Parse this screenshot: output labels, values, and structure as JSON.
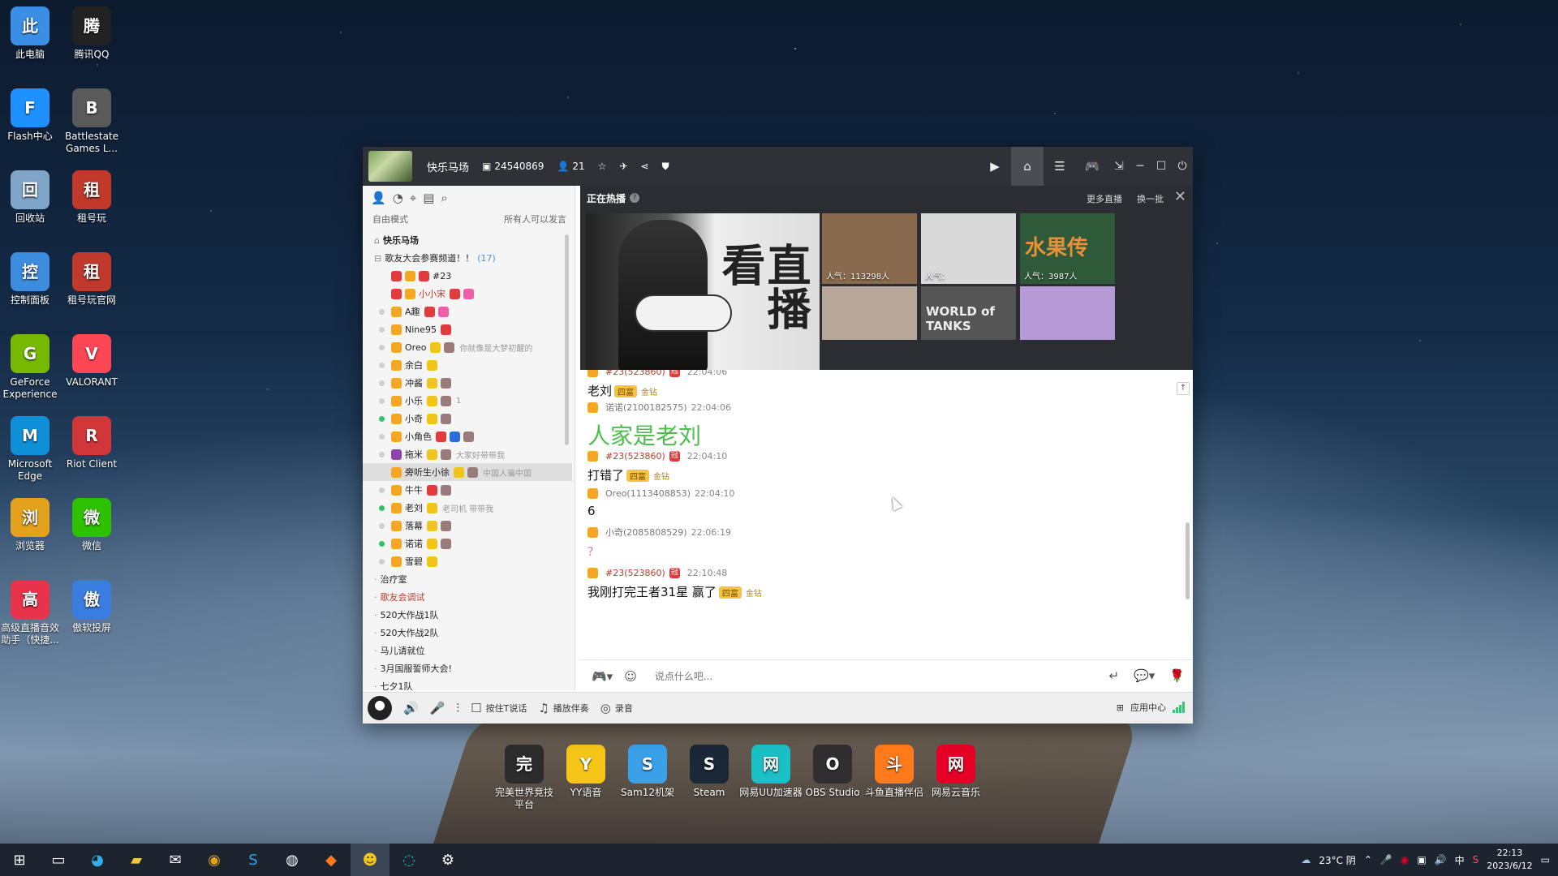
{
  "desktop": {
    "icons_left": [
      {
        "label": "此电脑",
        "icon": "computer-icon",
        "color": "#3a8ee6"
      },
      {
        "label": "腾讯QQ",
        "icon": "qq-icon",
        "color": "#222222"
      },
      {
        "label": "Flash中心",
        "icon": "flash-icon",
        "color": "#1e90ff"
      },
      {
        "label": "Battlestate Games L...",
        "icon": "battlestate-icon",
        "color": "#5a5a5a"
      },
      {
        "label": "回收站",
        "icon": "recycle-bin-icon",
        "color": "#7fa6c9"
      },
      {
        "label": "租号玩",
        "icon": "zuhaowan-icon",
        "color": "#c0392b"
      },
      {
        "label": "控制面板",
        "icon": "control-panel-icon",
        "color": "#3c8dde"
      },
      {
        "label": "租号玩官网",
        "icon": "zuhaowan-site-icon",
        "color": "#c0392b"
      },
      {
        "label": "GeForce Experience",
        "icon": "geforce-icon",
        "color": "#76b900"
      },
      {
        "label": "VALORANT",
        "icon": "valorant-icon",
        "color": "#ff4655"
      },
      {
        "label": "Microsoft Edge",
        "icon": "edge-icon",
        "color": "#0f8fd8"
      },
      {
        "label": "Riot Client",
        "icon": "riot-icon",
        "color": "#d13639"
      },
      {
        "label": "浏览器",
        "icon": "chrome-icon",
        "color": "#e4a11b"
      },
      {
        "label": "微信",
        "icon": "wechat-icon",
        "color": "#2dc100"
      },
      {
        "label": "高级直播音效助手（快捷...",
        "icon": "audio-assistant-icon",
        "color": "#e8334a"
      },
      {
        "label": "傲软投屏",
        "icon": "apowermirror-icon",
        "color": "#3a7de0"
      }
    ],
    "icons_bottom": [
      {
        "label": "完美世界竞技平台",
        "icon": "perfect-world-icon",
        "color": "#2c2c2c"
      },
      {
        "label": "YY语音",
        "icon": "yy-icon",
        "color": "#f5c518"
      },
      {
        "label": "Sam12机架",
        "icon": "sam-rack-icon",
        "color": "#3aa0e8"
      },
      {
        "label": "Steam",
        "icon": "steam-icon",
        "color": "#1b2838"
      },
      {
        "label": "网易UU加速器",
        "icon": "uu-booster-icon",
        "color": "#1ac0c6"
      },
      {
        "label": "OBS Studio",
        "icon": "obs-icon",
        "color": "#302e31"
      },
      {
        "label": "斗鱼直播伴侣",
        "icon": "douyu-icon",
        "color": "#ff7a1a"
      },
      {
        "label": "网易云音乐",
        "icon": "netease-music-icon",
        "color": "#e60026"
      }
    ]
  },
  "window": {
    "channel_name": "快乐马场",
    "channel_id": "24540869",
    "online_count": "21",
    "mode_label": "自由模式",
    "mode_desc": "所有人可以发言"
  },
  "tree": [
    {
      "type": "channel",
      "name": "快乐马场",
      "bold": true,
      "indent": 14
    },
    {
      "type": "channel",
      "name": "歌友大会参赛频道！！",
      "count": "(17)",
      "indent": 14,
      "open": true
    },
    {
      "type": "user",
      "name": "#23",
      "dot": "none",
      "badges": [
        "b-red",
        "b-gift",
        "b-red"
      ],
      "status": ""
    },
    {
      "type": "user",
      "name": "小小宋",
      "dot": "none",
      "badges": [
        "b-red",
        "b-gift"
      ],
      "tail": [
        "b-red",
        "b-pink"
      ],
      "status": "",
      "red": true
    },
    {
      "type": "user",
      "name": "A趣",
      "dot": "gray",
      "badges": [
        "b-gift"
      ],
      "tail": [
        "b-red",
        "b-pink"
      ],
      "status": ""
    },
    {
      "type": "user",
      "name": "Nine95",
      "dot": "gray",
      "badges": [
        "b-gift"
      ],
      "tail": [
        "b-red"
      ],
      "status": ""
    },
    {
      "type": "user",
      "name": "Oreo",
      "dot": "gray",
      "badges": [
        "b-gift"
      ],
      "tail": [
        "b-crown",
        "b-gray"
      ],
      "status": "你就像是大梦初醒的"
    },
    {
      "type": "user",
      "name": "余白",
      "dot": "gray",
      "badges": [
        "b-gift"
      ],
      "tail": [
        "b-crown"
      ],
      "status": ""
    },
    {
      "type": "user",
      "name": "冲酱",
      "dot": "gray",
      "badges": [
        "b-gift"
      ],
      "tail": [
        "b-crown",
        "b-gray"
      ],
      "status": ""
    },
    {
      "type": "user",
      "name": "小乐",
      "dot": "gray",
      "badges": [
        "b-gift"
      ],
      "tail": [
        "b-crown",
        "b-gray"
      ],
      "status": "1"
    },
    {
      "type": "user",
      "name": "小奇",
      "dot": "green",
      "badges": [
        "b-gift"
      ],
      "tail": [
        "b-crown",
        "b-gray"
      ],
      "status": ""
    },
    {
      "type": "user",
      "name": "小角色",
      "dot": "gray",
      "badges": [
        "b-gift"
      ],
      "tail": [
        "b-red",
        "b-blue",
        "b-gray"
      ],
      "status": ""
    },
    {
      "type": "user",
      "name": "拖米",
      "dot": "gray",
      "badges": [
        "b-purple"
      ],
      "tail": [
        "b-crown",
        "b-gray"
      ],
      "status": "大家好带带我"
    },
    {
      "type": "user",
      "name": "旁听生小徐",
      "dot": "none",
      "badges": [
        "b-gift"
      ],
      "tail": [
        "b-crown",
        "b-gray"
      ],
      "status": "中国人骗中国",
      "sel": true
    },
    {
      "type": "user",
      "name": "牛牛",
      "dot": "gray",
      "badges": [
        "b-gift"
      ],
      "tail": [
        "b-red",
        "b-gray"
      ],
      "status": ""
    },
    {
      "type": "user",
      "name": "老刘",
      "dot": "green",
      "badges": [
        "b-gift"
      ],
      "tail": [
        "b-crown"
      ],
      "status": "老司机 带带我"
    },
    {
      "type": "user",
      "name": "落幕",
      "dot": "gray",
      "badges": [
        "b-gift"
      ],
      "tail": [
        "b-crown",
        "b-gray"
      ],
      "status": ""
    },
    {
      "type": "user",
      "name": "诺诺",
      "dot": "green",
      "badges": [
        "b-gift"
      ],
      "tail": [
        "b-crown",
        "b-gray"
      ],
      "status": ""
    },
    {
      "type": "user",
      "name": "雪碧",
      "dot": "gray",
      "badges": [
        "b-gift"
      ],
      "tail": [
        "b-crown"
      ],
      "status": ""
    },
    {
      "type": "channel",
      "name": "治疗室",
      "indent": 14
    },
    {
      "type": "channel",
      "name": "歌友会调试",
      "indent": 14,
      "red": true
    },
    {
      "type": "channel",
      "name": "520大作战1队",
      "indent": 14
    },
    {
      "type": "channel",
      "name": "520大作战2队",
      "indent": 14
    },
    {
      "type": "channel",
      "name": "马儿请就位",
      "indent": 14
    },
    {
      "type": "channel",
      "name": "3月国服誓师大会!",
      "indent": 14
    },
    {
      "type": "channel",
      "name": "七夕1队",
      "indent": 14
    }
  ],
  "hot": {
    "title": "正在热播",
    "more": "更多直播",
    "refresh": "换一批",
    "big_text": "直播看",
    "thumbs": [
      {
        "pop": "人气：113298人",
        "color": "#8a6a4e"
      },
      {
        "pop": "人气：",
        "color": "#d9d9d9"
      },
      {
        "pop": "人气：3987人",
        "color": "#2f5a3a",
        "text": "水果传"
      },
      {
        "pop": "",
        "color": "#b7a89a"
      },
      {
        "pop": "",
        "color": "#555555",
        "text": "WORLD of TANKS"
      },
      {
        "pop": "",
        "color": "#b69ad6"
      }
    ]
  },
  "chat": {
    "messages": [
      {
        "name": "#23(523860)",
        "time": "22:04:06",
        "body": "老刘",
        "gold": "金钻",
        "tag": "四富",
        "style": "normal"
      },
      {
        "name": "诺诺(2100182575)",
        "time": "22:04:06",
        "body": "人家是老刘",
        "style": "big",
        "dark": true
      },
      {
        "name": "#23(523860)",
        "time": "22:04:10",
        "body": "打错了",
        "gold": "金钻",
        "tag": "四富",
        "style": "normal"
      },
      {
        "name": "Oreo(1113408853)",
        "time": "22:04:10",
        "body": "6",
        "style": "normal",
        "dark": true
      },
      {
        "name": "小奇(2085808529)",
        "time": "22:06:19",
        "body": "？",
        "style": "pink",
        "dark": true
      },
      {
        "name": "#23(523860)",
        "time": "22:10:48",
        "body": "我刚打完王者31星    赢了",
        "gold": "金钻",
        "tag": "四富",
        "style": "normal"
      }
    ],
    "input_placeholder": "说点什么吧..."
  },
  "bottombar": {
    "push_to_talk": "按住T说话",
    "accompany": "播放伴奏",
    "record": "录音",
    "app_center": "应用中心"
  },
  "taskbar": {
    "weather": "23°C  阴",
    "ime": "中",
    "time": "22:13",
    "date": "2023/6/12"
  }
}
